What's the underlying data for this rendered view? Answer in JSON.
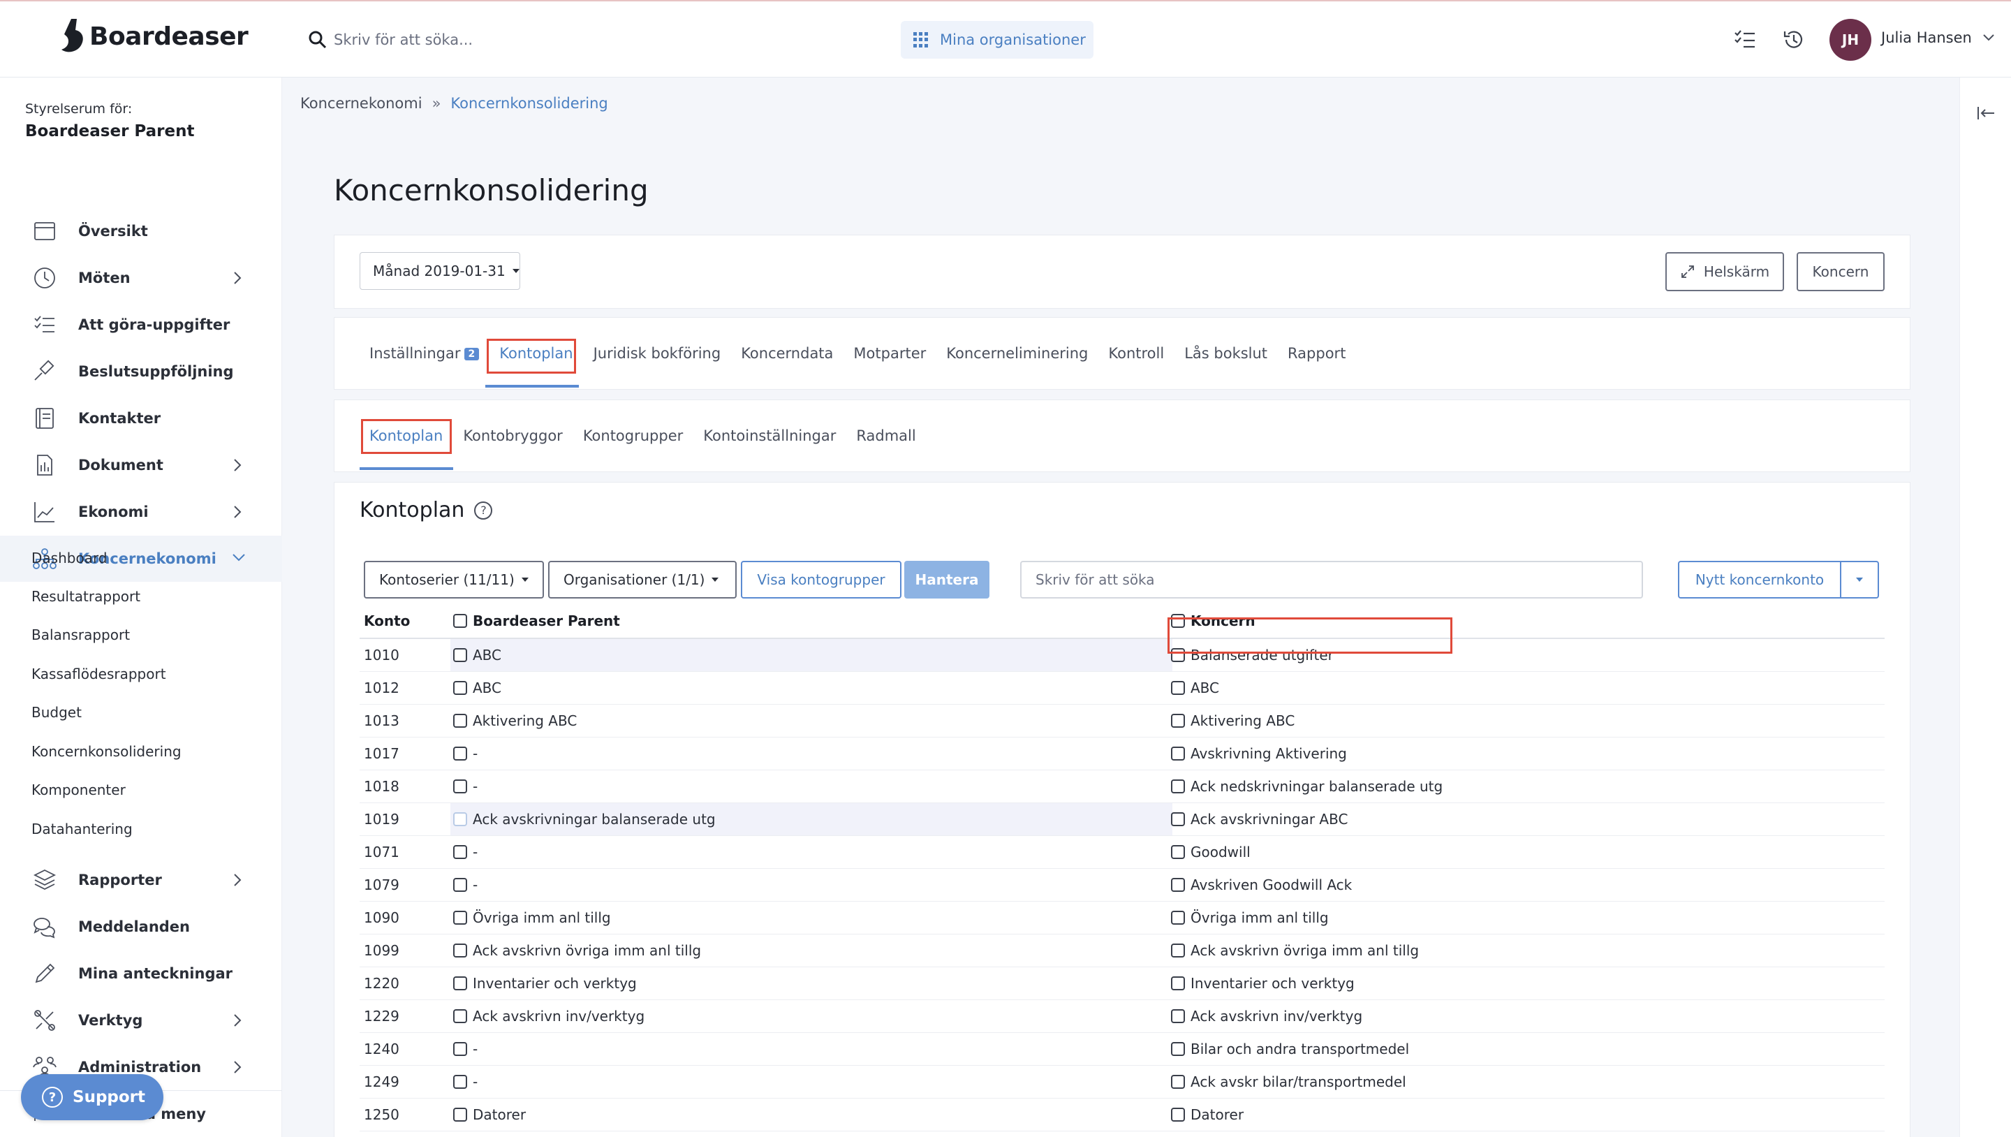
{
  "header": {
    "logo_text": "Boardeaser",
    "search_placeholder": "Skriv för att söka...",
    "org_button_label": "Mina organisationer",
    "user": {
      "initials": "JH",
      "name": "Julia Hansen"
    }
  },
  "sidebar": {
    "room_label": "Styrelserum för:",
    "room_name": "Boardeaser Parent",
    "items": [
      {
        "label": "Översikt",
        "icon": "calendar-icon"
      },
      {
        "label": "Möten",
        "icon": "clock-icon"
      },
      {
        "label": "Att göra-uppgifter",
        "icon": "checklist-icon"
      },
      {
        "label": "Beslutsuppföljning",
        "icon": "gavel-icon"
      },
      {
        "label": "Kontakter",
        "icon": "contacts-icon"
      },
      {
        "label": "Dokument",
        "icon": "document-icon"
      },
      {
        "label": "Ekonomi",
        "icon": "chart-icon"
      },
      {
        "label": "Koncernekonomi",
        "icon": "org-tree-icon"
      }
    ],
    "sub_items": [
      "Dashboard",
      "Resultatrapport",
      "Balansrapport",
      "Kassaflödesrapport",
      "Budget",
      "Koncernkonsolidering",
      "Komponenter",
      "Datahantering"
    ],
    "bottom_items": [
      {
        "label": "Rapporter",
        "icon": "layers-icon"
      },
      {
        "label": "Meddelanden",
        "icon": "chat-icon"
      },
      {
        "label": "Mina anteckningar",
        "icon": "pencil-icon"
      },
      {
        "label": "Verktyg",
        "icon": "tools-icon"
      },
      {
        "label": "Administration",
        "icon": "users-icon"
      },
      {
        "label": "Minimera meny",
        "icon": "collapse-left-icon"
      }
    ],
    "support_label": "Support"
  },
  "breadcrumb": {
    "parent": "Koncernekonomi",
    "current": "Koncernkonsolidering"
  },
  "page_title": "Koncernkonsolidering",
  "toolbar": {
    "month_select": "Månad 2019-01-31",
    "fullscreen_label": "Helskärm",
    "koncern_label": "Koncern"
  },
  "main_tabs": {
    "items": [
      "Inställningar",
      "Kontoplan",
      "Juridisk bokföring",
      "Koncerndata",
      "Motparter",
      "Koncerneliminering",
      "Kontroll",
      "Lås bokslut",
      "Rapport"
    ],
    "badge": "2",
    "active": "Kontoplan"
  },
  "sub_tabs": {
    "items": [
      "Kontoplan",
      "Kontobryggor",
      "Kontogrupper",
      "Kontoinställningar",
      "Radmall"
    ],
    "active": "Kontoplan"
  },
  "kontoplan": {
    "title": "Kontoplan",
    "filters": {
      "kontoserier": "Kontoserier (11/11)",
      "organisationer": "Organisationer (1/1)",
      "visa_kontogrupper": "Visa kontogrupper",
      "hantera": "Hantera",
      "search_placeholder": "Skriv för att söka",
      "nytt_koncernkonto": "Nytt koncernkonto"
    },
    "columns": {
      "konto": "Konto",
      "parent": "Boardeaser Parent",
      "koncern": "Koncern"
    },
    "rows": [
      {
        "konto": "1010",
        "parent": "ABC",
        "koncern": "Balanserade utgifter"
      },
      {
        "konto": "1012",
        "parent": "ABC",
        "koncern": "ABC"
      },
      {
        "konto": "1013",
        "parent": "Aktivering ABC",
        "koncern": "Aktivering ABC"
      },
      {
        "konto": "1017",
        "parent": "-",
        "koncern": "Avskrivning Aktivering"
      },
      {
        "konto": "1018",
        "parent": "-",
        "koncern": "Ack nedskrivningar balanserade utg"
      },
      {
        "konto": "1019",
        "parent": "Ack avskrivningar balanserade utg",
        "koncern": "Ack avskrivningar ABC"
      },
      {
        "konto": "1071",
        "parent": "-",
        "koncern": "Goodwill"
      },
      {
        "konto": "1079",
        "parent": "-",
        "koncern": "Avskriven Goodwill Ack"
      },
      {
        "konto": "1090",
        "parent": "Övriga imm anl tillg",
        "koncern": "Övriga imm anl tillg"
      },
      {
        "konto": "1099",
        "parent": "Ack avskrivn övriga imm anl tillg",
        "koncern": "Ack avskrivn övriga imm anl tillg"
      },
      {
        "konto": "1220",
        "parent": "Inventarier och verktyg",
        "koncern": "Inventarier och verktyg"
      },
      {
        "konto": "1229",
        "parent": "Ack avskrivn inv/verktyg",
        "koncern": "Ack avskrivn inv/verktyg"
      },
      {
        "konto": "1240",
        "parent": "-",
        "koncern": "Bilar och andra transportmedel"
      },
      {
        "konto": "1249",
        "parent": "-",
        "koncern": "Ack avskr bilar/transportmedel"
      },
      {
        "konto": "1250",
        "parent": "Datorer",
        "koncern": "Datorer"
      }
    ]
  },
  "colors": {
    "accent": "#5b8bd2",
    "highlight": "#e04a3a",
    "avatar": "#6b2f4a"
  }
}
